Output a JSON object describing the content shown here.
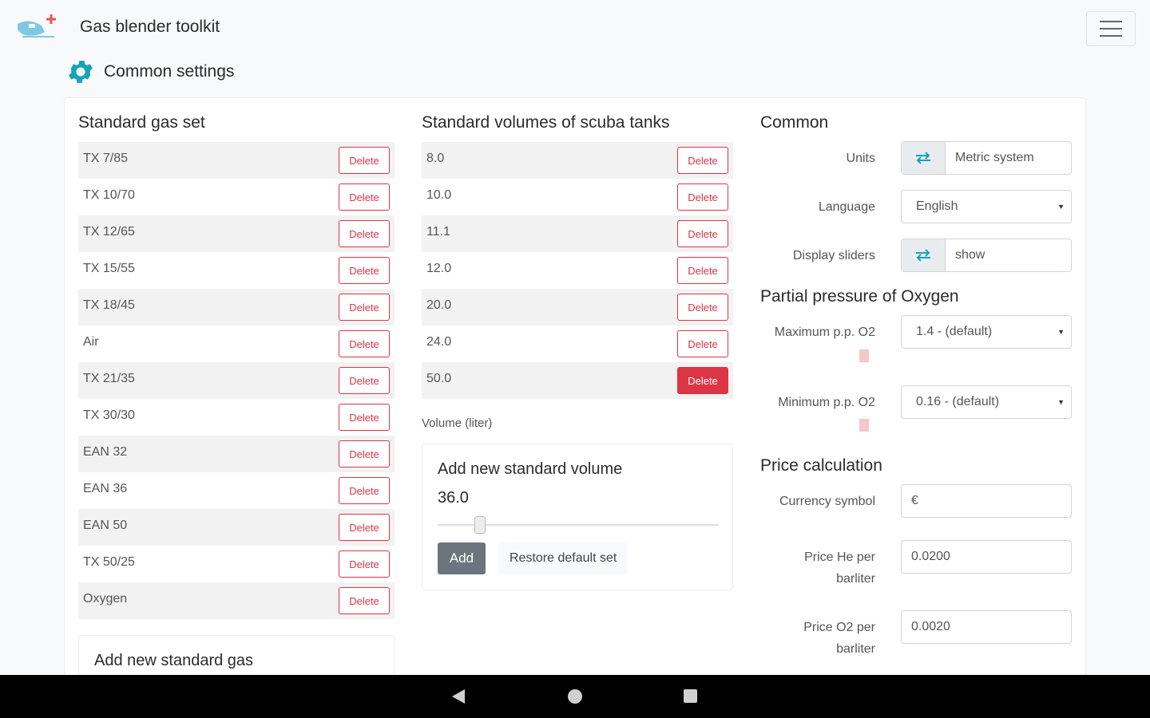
{
  "app": {
    "title": "Gas blender toolkit"
  },
  "page": {
    "heading": "Common settings"
  },
  "gas_set": {
    "title": "Standard gas set",
    "delete_label": "Delete",
    "items": [
      "TX 7/85",
      "TX 10/70",
      "TX 12/65",
      "TX 15/55",
      "TX 18/45",
      "Air",
      "TX 21/35",
      "TX 30/30",
      "EAN 32",
      "EAN 36",
      "EAN 50",
      "TX 50/25",
      "Oxygen"
    ],
    "add_title": "Add new standard gas"
  },
  "volumes": {
    "title": "Standard volumes of scuba tanks",
    "delete_label": "Delete",
    "items": [
      "8.0",
      "10.0",
      "11.1",
      "12.0",
      "20.0",
      "24.0",
      "50.0"
    ],
    "active_index": 6,
    "volume_label": "Volume (liter)",
    "add_title": "Add new standard volume",
    "new_value": "36.0",
    "slider_fraction": 0.15,
    "add_button": "Add",
    "restore_button": "Restore default set"
  },
  "common": {
    "title": "Common",
    "units_label": "Units",
    "units_value": "Metric system",
    "language_label": "Language",
    "language_value": "English",
    "sliders_label": "Display sliders",
    "sliders_value": "show"
  },
  "oxygen": {
    "title": "Partial pressure of Oxygen",
    "max_label": "Maximum p.p. O2",
    "max_value": "1.4 - (default)",
    "min_label": "Minimum p.p. O2",
    "min_value": "0.16 - (default)"
  },
  "price": {
    "title": "Price calculation",
    "currency_label": "Currency symbol",
    "currency_value": "€",
    "he_label": "Price He per barliter",
    "he_value": "0.0200",
    "o2_label": "Price O2 per barliter",
    "o2_value": "0.0020"
  },
  "colors": {
    "danger": "#dc3545",
    "accent": "#17a2b8",
    "secondary": "#6c757d"
  },
  "icons": {
    "logo": "helicopter-logo-icon",
    "settings": "gear-icon",
    "menu": "hamburger-icon",
    "swap": "swap-arrows-icon"
  }
}
